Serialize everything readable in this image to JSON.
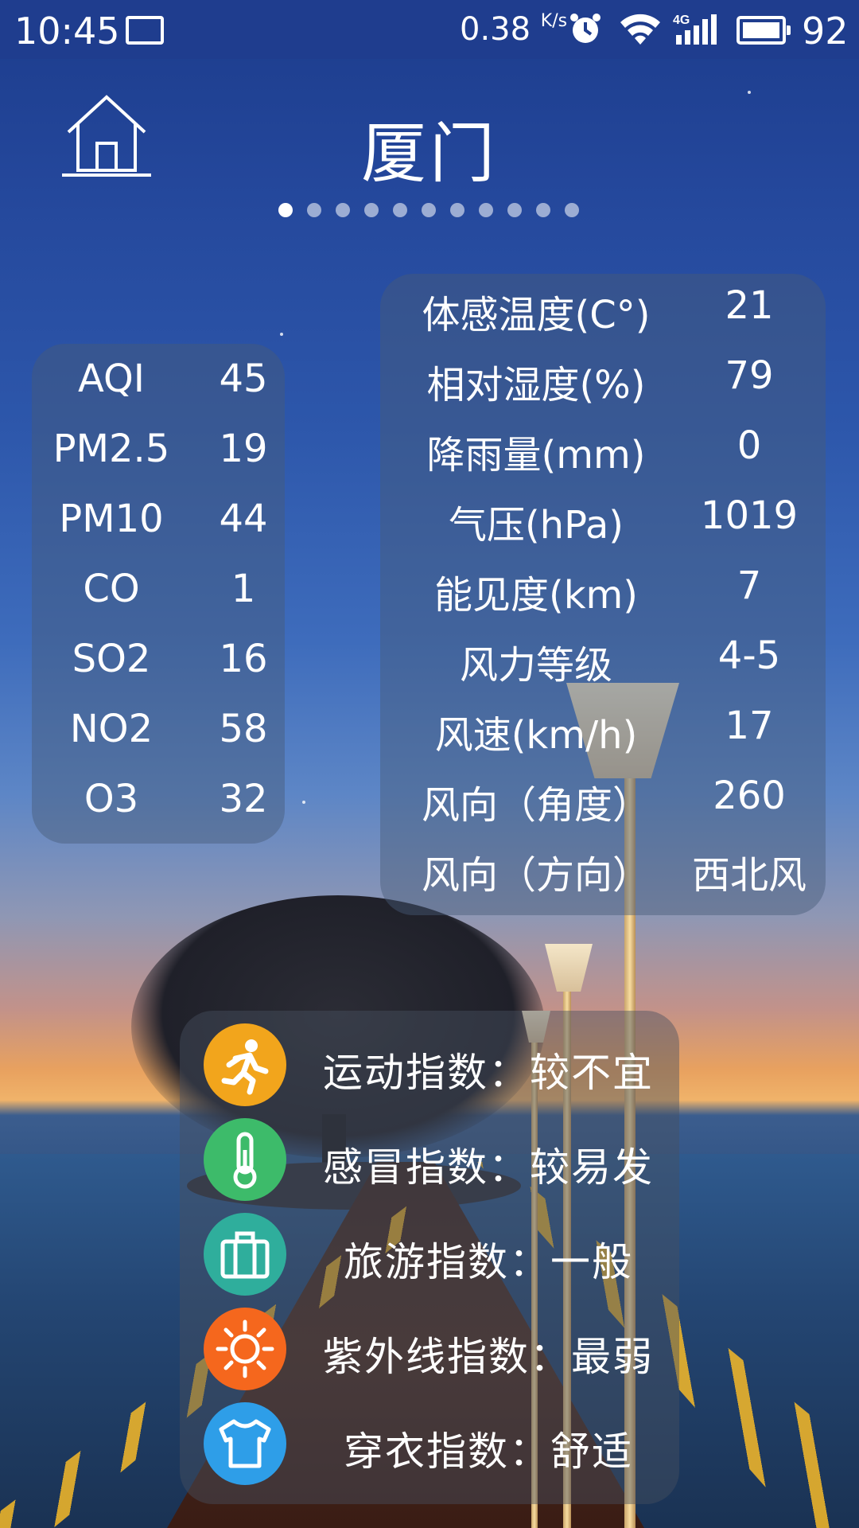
{
  "status_bar": {
    "time": "10:45",
    "net_speed": "0.38",
    "net_speed_unit": "K/s",
    "network": "4G",
    "battery_level": "92"
  },
  "header": {
    "city": "厦门",
    "page_count": 11,
    "active_page": 0
  },
  "air_quality": [
    {
      "label": "AQI",
      "value": "45"
    },
    {
      "label": "PM2.5",
      "value": "19"
    },
    {
      "label": "PM10",
      "value": "44"
    },
    {
      "label": "CO",
      "value": "1"
    },
    {
      "label": "SO2",
      "value": "16"
    },
    {
      "label": "NO2",
      "value": "58"
    },
    {
      "label": "O3",
      "value": "32"
    }
  ],
  "weather_details": [
    {
      "label": "体感温度(C°)",
      "value": "21"
    },
    {
      "label": "相对湿度(%)",
      "value": "79"
    },
    {
      "label": "降雨量(mm)",
      "value": "0"
    },
    {
      "label": "气压(hPa)",
      "value": "1019"
    },
    {
      "label": "能见度(km)",
      "value": "7"
    },
    {
      "label": "风力等级",
      "value": "4-5"
    },
    {
      "label": "风速(km/h)",
      "value": "17"
    },
    {
      "label": "风向（角度）",
      "value": "260"
    },
    {
      "label": "风向（方向）",
      "value": "西北风"
    }
  ],
  "life_indices": [
    {
      "icon": "running-icon",
      "color": "#f2a51c",
      "text": "运动指数：较不宜"
    },
    {
      "icon": "thermometer-icon",
      "color": "#3dbb6a",
      "text": "感冒指数：较易发"
    },
    {
      "icon": "luggage-icon",
      "color": "#2fae9c",
      "text": "旅游指数：一般"
    },
    {
      "icon": "sun-icon",
      "color": "#f5671d",
      "text": "紫外线指数：最弱"
    },
    {
      "icon": "tshirt-icon",
      "color": "#2e9ee8",
      "text": "穿衣指数：舒适"
    }
  ]
}
